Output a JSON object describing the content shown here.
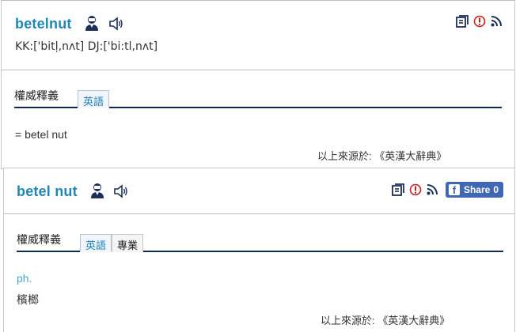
{
  "entries": [
    {
      "word": "betelnut",
      "phonetic": "KK:['bitḷ,nʌt] DJ:['bi:tl,nʌt]",
      "section_title": "權威釋義",
      "tabs": [
        {
          "label": "英語",
          "active": true
        }
      ],
      "definition": "= betel nut",
      "source": "以上來源於: 《英漢大辭典》"
    },
    {
      "word": "betel nut",
      "section_title": "權威釋義",
      "tabs": [
        {
          "label": "英語",
          "active": true
        },
        {
          "label": "專業",
          "active": false
        }
      ],
      "part_of_speech": "ph.",
      "definition": "檳榔",
      "source": "以上來源於: 《英漢大辭典》",
      "share": {
        "label": "Share",
        "count": "0"
      }
    }
  ],
  "icons": {
    "pronunciation_person": "person-icon",
    "audio": "speaker-icon",
    "save": "save-icon",
    "report": "report-icon",
    "feed": "rss-icon",
    "facebook": "facebook-icon"
  },
  "colors": {
    "headword": "#1f86b8",
    "section_rule": "#132a56",
    "part_of_speech": "#4aa6c9",
    "share_button": "#4267b2",
    "report_red": "#cc1f1f"
  }
}
